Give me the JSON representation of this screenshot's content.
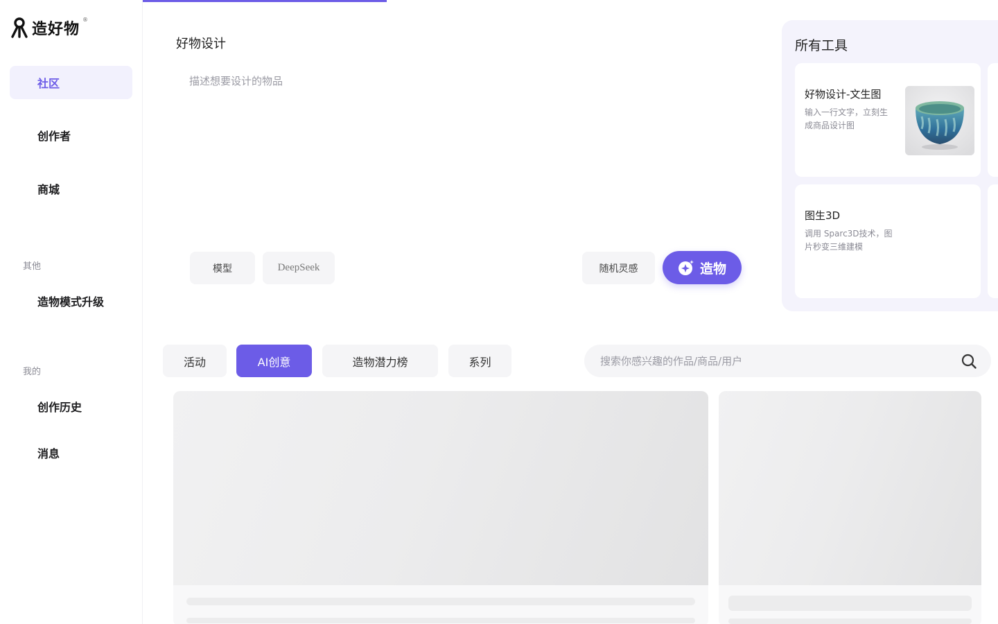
{
  "app": {
    "logo_text": "造好物",
    "logo_tm": "®"
  },
  "sidebar": {
    "items": [
      {
        "label": "社区",
        "active": true
      },
      {
        "label": "创作者",
        "active": false
      },
      {
        "label": "商城",
        "active": false
      }
    ],
    "groups": [
      {
        "title": "其他",
        "items": [
          {
            "label": "造物模式升级"
          }
        ]
      },
      {
        "title": "我的",
        "items": [
          {
            "label": "创作历史"
          },
          {
            "label": "消息"
          }
        ]
      }
    ]
  },
  "prompt": {
    "title": "好物设计",
    "placeholder": "描述想要设计的物品",
    "value": "",
    "chips": {
      "model": "模型",
      "deepseek": "DeepSeek",
      "random": "随机灵感"
    },
    "create_label": "造物"
  },
  "tools": {
    "title": "所有工具",
    "cards": [
      {
        "name": "好物设计-文生图",
        "desc": "输入一行文字，立刻生成商品设计图",
        "thumb": "ceramic-bowl"
      },
      {
        "name": "图生3D",
        "desc": "调用 Sparc3D技术，图片秒变三维建模",
        "thumb": ""
      }
    ]
  },
  "filters": {
    "tabs": [
      {
        "label": "活动",
        "active": false
      },
      {
        "label": "AI创意",
        "active": true
      },
      {
        "label": "造物潜力榜",
        "active": false
      },
      {
        "label": "系列",
        "active": false
      }
    ],
    "search_placeholder": "搜索你感兴趣的作品/商品/用户",
    "search_value": ""
  },
  "colors": {
    "accent": "#6c5ce7",
    "accent_light": "#f2f1fd",
    "panel_bg": "#f4f3fc",
    "chip_bg": "#f5f5f7"
  }
}
